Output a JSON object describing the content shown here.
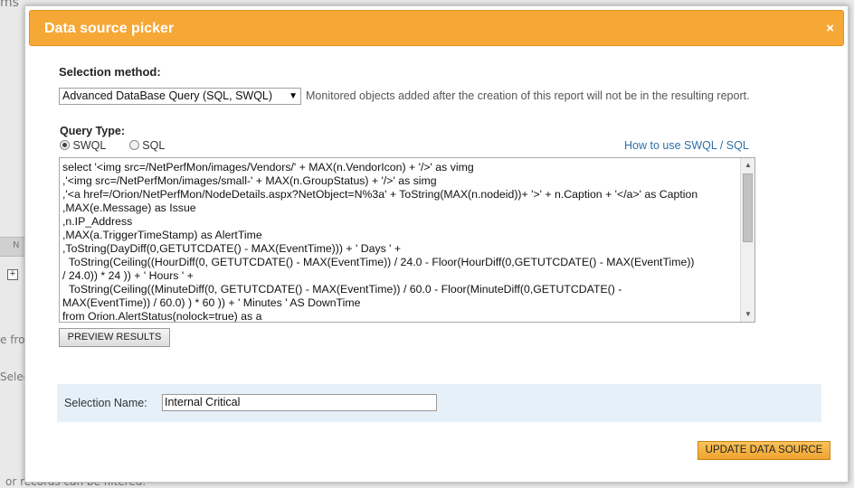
{
  "background": {
    "frag_top": "ms",
    "frag_no": "N",
    "frag_fro": "e fro",
    "frag_sele": "Selec",
    "frag_bottom": "or records can be filtered."
  },
  "dialog": {
    "title": "Data source picker",
    "close_glyph": "×",
    "selection_method_label": "Selection method:",
    "selection_method_value": "Advanced DataBase Query (SQL, SWQL)",
    "selection_method_note": "Monitored objects added after the creation of this report will not be in the resulting report.",
    "query_type_label": "Query Type:",
    "query_types": [
      {
        "label": "SWQL",
        "selected": true
      },
      {
        "label": "SQL",
        "selected": false
      }
    ],
    "help_link": "How to use SWQL / SQL",
    "query_text": "select '<img src=/NetPerfMon/images/Vendors/' + MAX(n.VendorIcon) + '/>' as vimg\n,'<img src=/NetPerfMon/images/small-' + MAX(n.GroupStatus) + '/>' as simg\n,'<a href=/Orion/NetPerfMon/NodeDetails.aspx?NetObject=N%3a' + ToString(MAX(n.nodeid))+ '>' + n.Caption + '</a>' as Caption\n,MAX(e.Message) as Issue\n,n.IP_Address\n,MAX(a.TriggerTimeStamp) as AlertTime\n,ToString(DayDiff(0,GETUTCDATE() - MAX(EventTime))) + ' Days ' +\n  ToString(Ceiling((HourDiff(0, GETUTCDATE() - MAX(EventTime)) / 24.0 - Floor(HourDiff(0,GETUTCDATE() - MAX(EventTime))\n/ 24.0)) * 24 )) + ' Hours ' +\n  ToString(Ceiling((MinuteDiff(0, GETUTCDATE() - MAX(EventTime)) / 60.0 - Floor(MinuteDiff(0,GETUTCDATE() -\nMAX(EventTime)) / 60.0) ) * 60 )) + ' Minutes ' AS DownTime\nfrom Orion.AlertStatus(nolock=true) as a",
    "preview_button": "PREVIEW RESULTS",
    "selection_name_label": "Selection Name:",
    "selection_name_value": "Internal Critical",
    "update_button": "UPDATE DATA SOURCE"
  },
  "colors": {
    "title_bar": "#f6a836",
    "link": "#2f6fa8",
    "panel": "#e5f0f9",
    "update_button": "#f0a331"
  }
}
